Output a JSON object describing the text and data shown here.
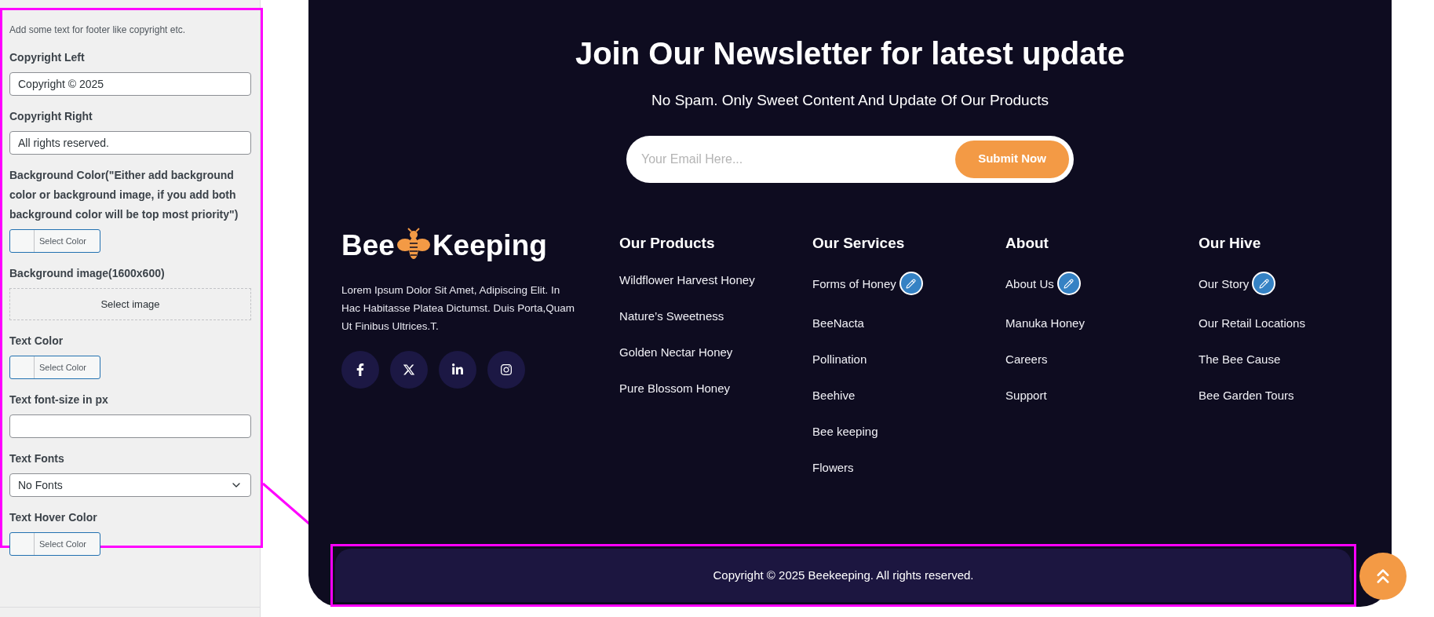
{
  "settings_panel": {
    "intro": "Add some text for footer like copyright etc.",
    "fields": [
      {
        "kind": "text",
        "label": "Copyright Left",
        "value": "Copyright © 2025"
      },
      {
        "kind": "text",
        "label": "Copyright Right",
        "value": "All rights reserved."
      },
      {
        "kind": "color",
        "label": "Background Color(\"Either add background color or background image, if you add both background color will be top most priority\")",
        "button": "Select Color"
      },
      {
        "kind": "image",
        "label": "Background image(1600x600)",
        "button": "Select image"
      },
      {
        "kind": "color",
        "label": "Text Color",
        "button": "Select Color"
      },
      {
        "kind": "text",
        "label": "Text font-size in px"
      },
      {
        "kind": "select",
        "label": "Text Fonts",
        "value": "No Fonts"
      },
      {
        "kind": "color",
        "label": "Text Hover Color",
        "button": "Select Color"
      }
    ]
  },
  "newsletter": {
    "title": "Join Our Newsletter for latest update",
    "subtitle": "No Spam. Only Sweet Content And Update Of Our Products",
    "placeholder": "Your Email Here...",
    "button": "Submit Now"
  },
  "brand": {
    "logo_left": "Bee",
    "logo_right": "Keeping",
    "description": "Lorem Ipsum Dolor Sit Amet, Adipiscing Elit. In Hac Habitasse Platea Dictumst. Duis Porta,Quam Ut Finibus Ultrices.T.",
    "social": [
      {
        "kind": "facebook"
      },
      {
        "kind": "x"
      },
      {
        "kind": "linkedin"
      },
      {
        "kind": "instagram"
      }
    ]
  },
  "columns": [
    {
      "title": "Our Products",
      "edit_badge": false,
      "items": [
        "Wildflower Harvest Honey",
        "Nature’s Sweetness",
        "Golden Nectar Honey",
        "Pure Blossom Honey"
      ]
    },
    {
      "title": "Our Services",
      "edit_badge": true,
      "items": [
        "Forms of Honey",
        "BeeNacta",
        "Pollination",
        "Beehive",
        "Bee keeping",
        "Flowers"
      ]
    },
    {
      "title": "About",
      "edit_badge": true,
      "items": [
        "About Us",
        "Manuka Honey",
        "Careers",
        "Support"
      ]
    },
    {
      "title": "Our Hive",
      "edit_badge": true,
      "items": [
        "Our Story",
        "Our Retail Locations",
        "The Bee Cause",
        "Bee Garden Tours"
      ]
    }
  ],
  "copyright": "Copyright © 2025 Beekeeping. All rights reserved."
}
